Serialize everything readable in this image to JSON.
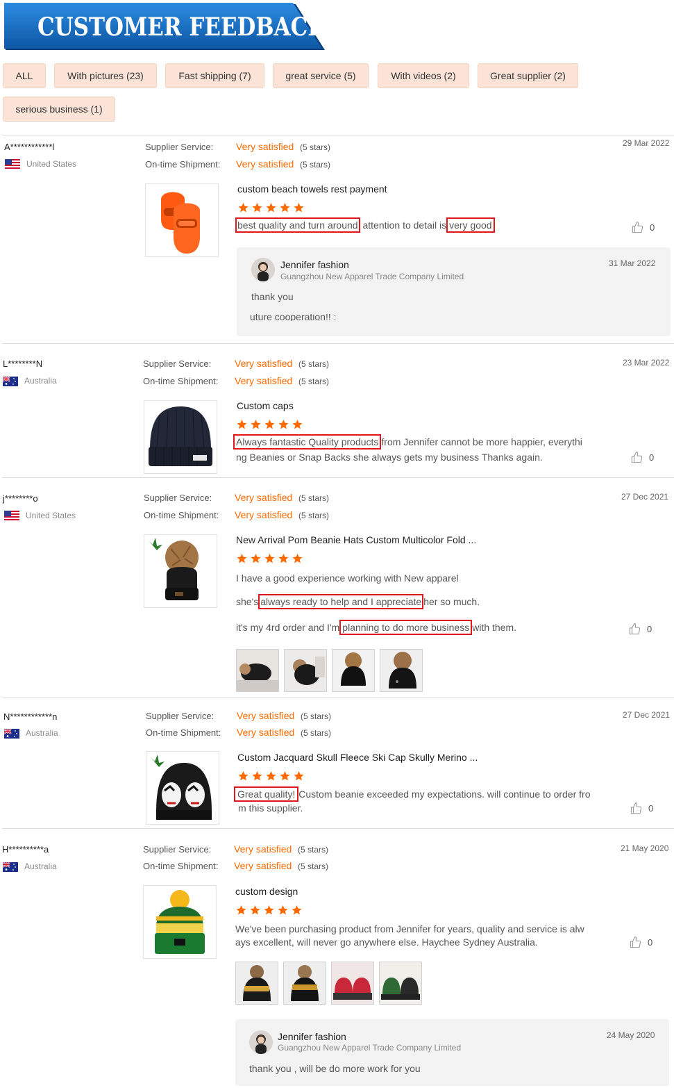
{
  "banner": {
    "title": "CUSTOMER FEEDBACK"
  },
  "filters": [
    "ALL",
    "With pictures (23)",
    "Fast shipping (7)",
    "great service (5)",
    "With videos (2)",
    "Great supplier (2)",
    "serious business (1)"
  ],
  "labels": {
    "supplier_service": "Supplier Service:",
    "ontime_shipment": "On-time Shipment:",
    "very_satisfied": "Very satisfied",
    "five_stars": "(5 stars)"
  },
  "reviews": [
    {
      "user": "A************l",
      "country": "United States",
      "date": "29 Mar 2022",
      "product": "custom beach towels rest payment",
      "comment_parts": [
        "best quality and turn around",
        " attention to detail is",
        "very good"
      ],
      "likes": "0",
      "reply": {
        "name": "Jennifer fashion",
        "company": "Guangzhou New Apparel Trade Company Limited",
        "date": "31 Mar 2022",
        "text": "thank you",
        "overflow_text": "uture cooperation!!  :"
      }
    },
    {
      "user": "L********N",
      "country": "Australia",
      "date": "23 Mar 2022",
      "product": "Custom caps",
      "comment_parts": [
        "Always fantastic Quality products",
        "from Jennifer cannot be more happier, everythi"
      ],
      "comment_line2": "ng Beanies or Snap Backs she always gets my business Thanks again.",
      "likes": "0"
    },
    {
      "user": "j********o",
      "country": "United States",
      "date": "27 Dec 2021",
      "product": "New Arrival Pom Beanie Hats Custom Multicolor Fold ...",
      "line1": "I have a good experience working with New apparel",
      "line2_parts": [
        "she's",
        "always ready to help and I appreciate",
        "her so much."
      ],
      "line3_parts": [
        "it's my 4rd order and I'm",
        "planning to do more business",
        "with them."
      ],
      "likes": "0"
    },
    {
      "user": "N************n",
      "country": "Australia",
      "date": "27 Dec 2021",
      "product": "Custom Jacquard Skull Fleece Ski Cap Skully Merino ...",
      "comment_parts": [
        "Great quality!",
        "Custom beanie exceeded my expectations. will continue to order fro"
      ],
      "comment_line2": "m this supplier.",
      "likes": "0"
    },
    {
      "user": "H**********a",
      "country": "Australia",
      "date": "21 May 2020",
      "product": "custom design",
      "comment_line1": "We've been purchasing product from Jennifer for years, quality and service is alw",
      "comment_line2": "ays excellent, will never go anywhere else. Haychee Sydney Australia.",
      "likes": "0",
      "reply": {
        "name": "Jennifer fashion",
        "company": "Guangzhou New Apparel Trade Company Limited",
        "date": "24 May 2020",
        "text": "thank  you , will be do more work for you"
      }
    }
  ],
  "colors": {
    "accent": "#ff6a00",
    "banner": "#1467b5",
    "tag_bg": "#fbe4d7",
    "highlight": "#e0161d"
  },
  "icons": {
    "star": "star-icon",
    "like": "thumbs-up-icon",
    "flag_us": "us-flag-icon",
    "flag_au": "australia-flag-icon"
  }
}
